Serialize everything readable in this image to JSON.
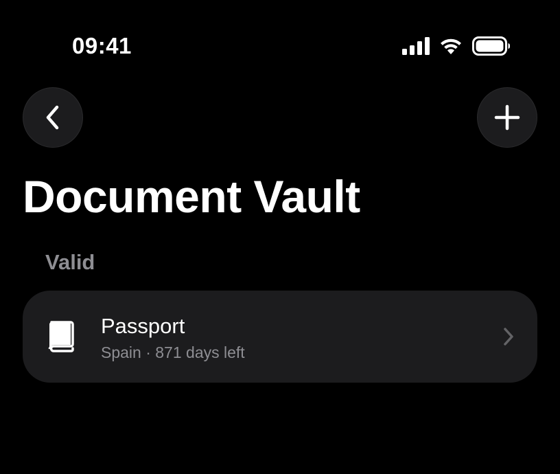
{
  "status_bar": {
    "time": "09:41",
    "icons": [
      "cellular-signal-icon",
      "wifi-icon",
      "battery-icon"
    ]
  },
  "nav": {
    "back_icon": "chevron-left-icon",
    "add_icon": "plus-icon"
  },
  "page_title": "Document Vault",
  "sections": [
    {
      "header": "Valid",
      "items": [
        {
          "icon": "book-icon",
          "title": "Passport",
          "subtitle": "Spain · 871 days left"
        }
      ]
    }
  ],
  "colors": {
    "background": "#000000",
    "card": "#1c1c1e",
    "secondary_text": "#8e8e93",
    "primary_text": "#ffffff"
  }
}
